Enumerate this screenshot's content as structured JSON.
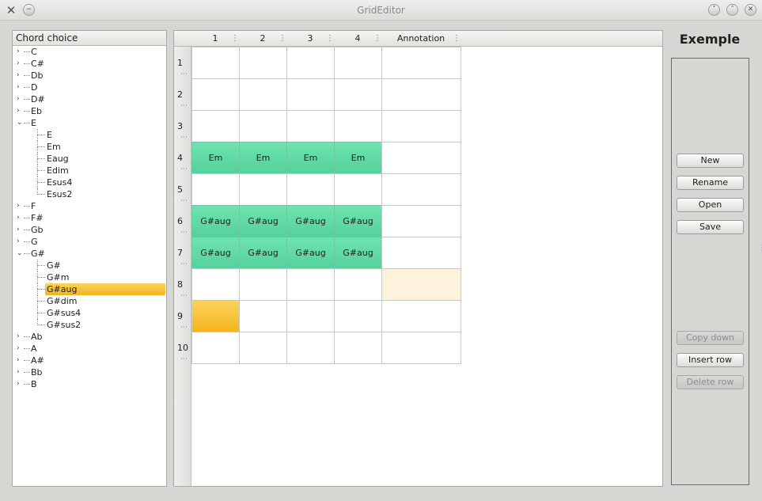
{
  "window": {
    "title": "GridEditor",
    "app_icon": "x-app-icon"
  },
  "tree": {
    "header": "Chord choice",
    "items": [
      {
        "label": "C",
        "expanded": false
      },
      {
        "label": "C#",
        "expanded": false
      },
      {
        "label": "Db",
        "expanded": false
      },
      {
        "label": "D",
        "expanded": false
      },
      {
        "label": "D#",
        "expanded": false
      },
      {
        "label": "Eb",
        "expanded": false
      },
      {
        "label": "E",
        "expanded": true,
        "children": [
          "E",
          "Em",
          "Eaug",
          "Edim",
          "Esus4",
          "Esus2"
        ]
      },
      {
        "label": "F",
        "expanded": false
      },
      {
        "label": "F#",
        "expanded": false
      },
      {
        "label": "Gb",
        "expanded": false
      },
      {
        "label": "G",
        "expanded": false
      },
      {
        "label": "G#",
        "expanded": true,
        "children": [
          "G#",
          "G#m",
          "G#aug",
          "G#dim",
          "G#sus4",
          "G#sus2"
        ]
      },
      {
        "label": "Ab",
        "expanded": false
      },
      {
        "label": "A",
        "expanded": false
      },
      {
        "label": "A#",
        "expanded": false
      },
      {
        "label": "Bb",
        "expanded": false
      },
      {
        "label": "B",
        "expanded": false
      }
    ],
    "selected": "G#aug"
  },
  "grid": {
    "columns": [
      "1",
      "2",
      "3",
      "4",
      "Annotation"
    ],
    "rows": [
      {
        "num": "1",
        "cells": [
          "",
          "",
          "",
          ""
        ],
        "annotation": ""
      },
      {
        "num": "2",
        "cells": [
          "",
          "",
          "",
          ""
        ],
        "annotation": ""
      },
      {
        "num": "3",
        "cells": [
          "",
          "",
          "",
          ""
        ],
        "annotation": ""
      },
      {
        "num": "4",
        "cells": [
          "Em",
          "Em",
          "Em",
          "Em"
        ],
        "annotation": ""
      },
      {
        "num": "5",
        "cells": [
          "",
          "",
          "",
          ""
        ],
        "annotation": ""
      },
      {
        "num": "6",
        "cells": [
          "G#aug",
          "G#aug",
          "G#aug",
          "G#aug"
        ],
        "annotation": ""
      },
      {
        "num": "7",
        "cells": [
          "G#aug",
          "G#aug",
          "G#aug",
          "G#aug"
        ],
        "annotation": ""
      },
      {
        "num": "8",
        "cells": [
          "",
          "",
          "",
          ""
        ],
        "annotation": ""
      },
      {
        "num": "9",
        "cells": [
          "",
          "",
          "",
          ""
        ],
        "annotation": ""
      },
      {
        "num": "10",
        "cells": [
          "",
          "",
          "",
          ""
        ],
        "annotation": ""
      }
    ],
    "current_cell": {
      "row": "9",
      "col": "1"
    },
    "highlighted_annotation_row": "8",
    "colors": {
      "chord_fill": "#5fdaa5",
      "current_fill": "#f6bf2c",
      "annotation_highlight": "#fdf3dc"
    }
  },
  "panel": {
    "title": "Exemple",
    "buttons": [
      {
        "id": "new",
        "label": "New",
        "enabled": true
      },
      {
        "id": "rename",
        "label": "Rename",
        "enabled": true
      },
      {
        "id": "open",
        "label": "Open",
        "enabled": true
      },
      {
        "id": "save",
        "label": "Save",
        "enabled": true
      },
      {
        "id": "copy-down",
        "label": "Copy down",
        "enabled": false
      },
      {
        "id": "insert-row",
        "label": "Insert row",
        "enabled": true
      },
      {
        "id": "delete-row",
        "label": "Delete row",
        "enabled": false
      }
    ]
  }
}
